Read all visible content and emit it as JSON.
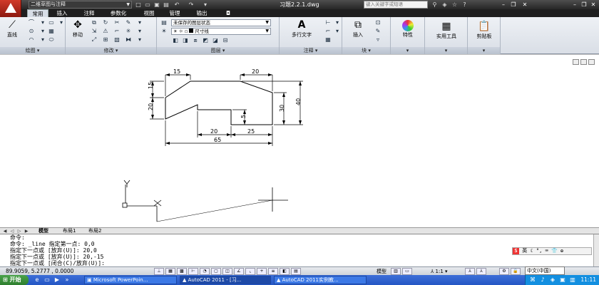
{
  "window": {
    "workspace": "二维草图与注释",
    "doc_title": "习题2.2.1.dwg",
    "search_placeholder": "键入关键字或短语"
  },
  "tabs": [
    "常用",
    "插入",
    "注释",
    "参数化",
    "视图",
    "管理",
    "输出"
  ],
  "ribbon": {
    "draw": {
      "label": "绘图",
      "line": "直线"
    },
    "modify": {
      "label": "修改",
      "move": "移动"
    },
    "layers": {
      "label": "图层",
      "state": "未保存的图层状态",
      "current": "尺寸线"
    },
    "annotation": {
      "label": "注释",
      "mtext": "多行文字"
    },
    "block": {
      "label": "块",
      "insert": "插入"
    },
    "properties": {
      "label": "特性"
    },
    "utilities": {
      "label": "实用工具"
    },
    "clipboard": {
      "label": "剪贴板"
    }
  },
  "dimensions": {
    "top_left": "15",
    "top_right": "20",
    "left_upper": "15",
    "left_lower": "20",
    "notch_depth": "5",
    "right_inner": "30",
    "right_outer": "40",
    "bottom_mid": "20",
    "bottom_right": "25",
    "overall": "65"
  },
  "ucs": {
    "y_label": "Y",
    "x_label": "X"
  },
  "layout_tabs": [
    "模型",
    "布局1",
    "布局2"
  ],
  "command_lines": [
    "命令:",
    "命令: _line 指定第一点: 0,0",
    "指定下一点或 [放弃(U)]: 20,0",
    "指定下一点或 [放弃(U)]: 20,-15",
    "指定下一点或 [闭合(C)/放弃(U)]:"
  ],
  "status": {
    "coords": "89.9059,  5.2777  , 0.0000",
    "model": "模型",
    "scale": "1:1"
  },
  "ime": {
    "label": "英"
  },
  "taskbar": {
    "start": "开始",
    "tasks": [
      "Microsoft PowerPoin...",
      "AutoCAD 2011 - [习...",
      "AutoCAD 2011实例教..."
    ],
    "language": "中文(中国)",
    "clock": "11:11"
  }
}
